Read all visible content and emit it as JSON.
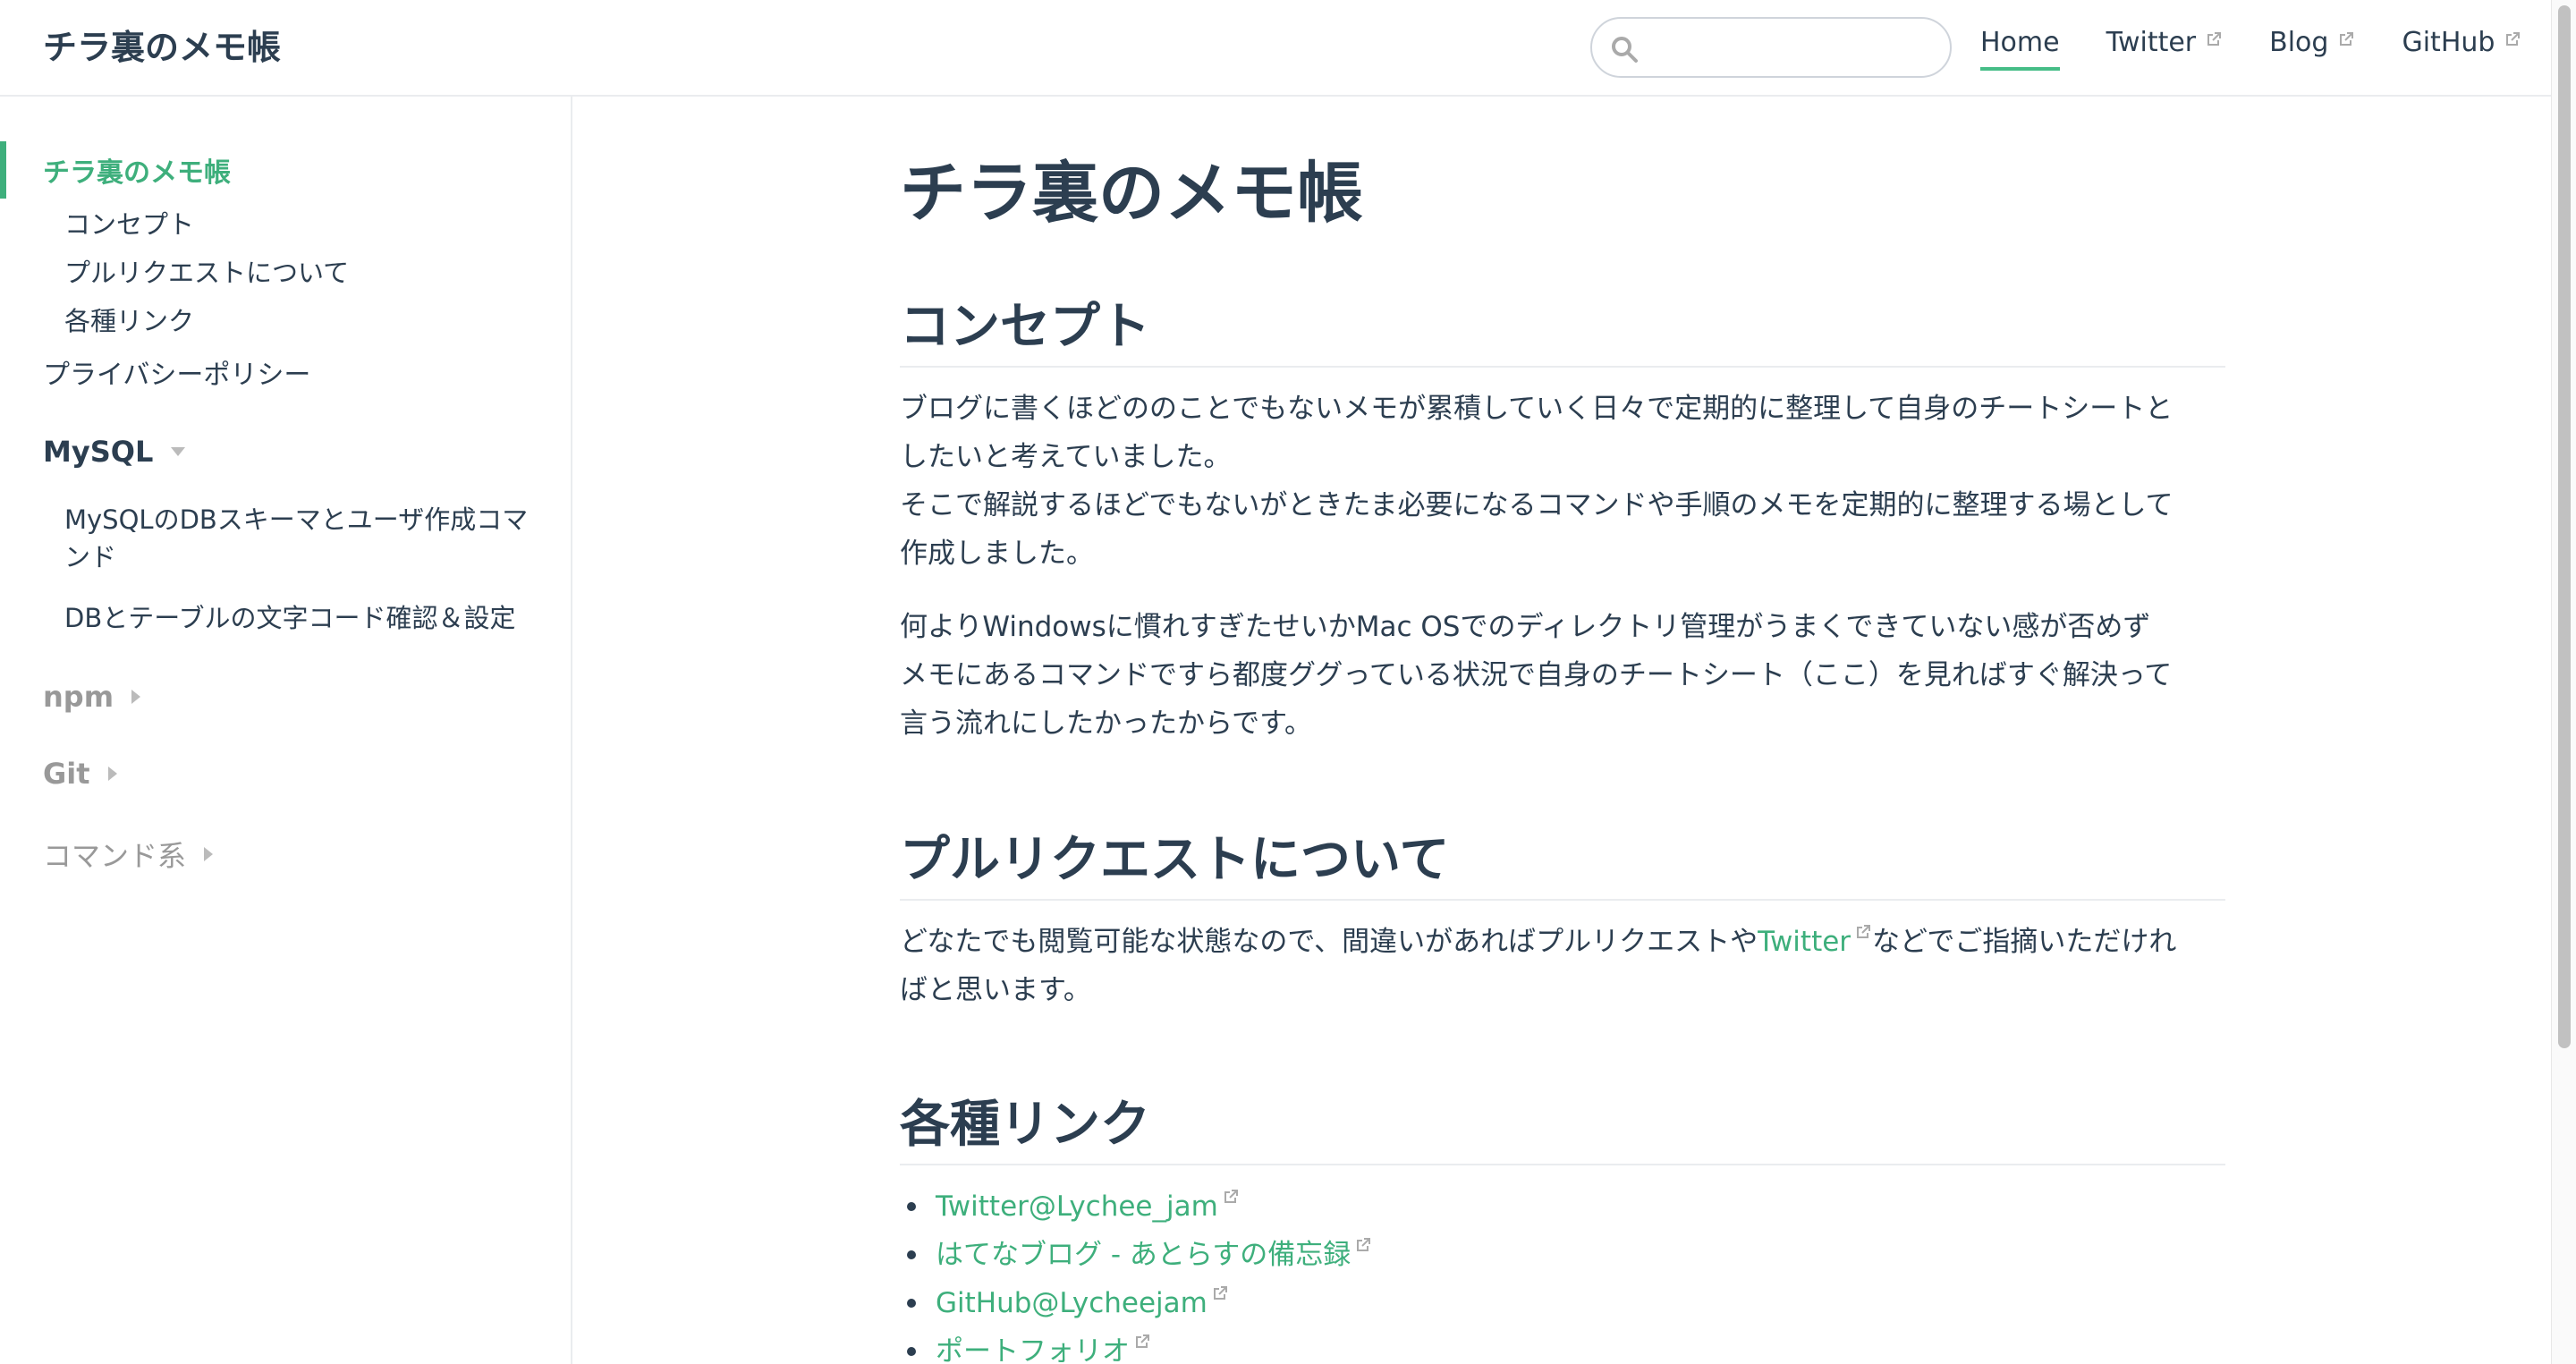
{
  "navbar": {
    "site_name": "チラ裏のメモ帳",
    "search": {
      "placeholder": "",
      "value": ""
    },
    "links": [
      {
        "label": "Home",
        "active": true,
        "external": false
      },
      {
        "label": "Twitter",
        "active": false,
        "external": true
      },
      {
        "label": "Blog",
        "active": false,
        "external": true
      },
      {
        "label": "GitHub",
        "active": false,
        "external": true
      }
    ]
  },
  "sidebar": {
    "top_item": "チラ裏のメモ帳",
    "sub_items": [
      "コンセプト",
      "プルリクエストについて",
      "各種リンク"
    ],
    "privacy": "プライバシーポリシー",
    "groups": [
      {
        "title": "MySQL",
        "expanded": true,
        "items": [
          "MySQLのDBスキーマとユーザ作成コマンド",
          "DBとテーブルの文字コード確認＆設定"
        ]
      },
      {
        "title": "npm",
        "expanded": false
      },
      {
        "title": "Git",
        "expanded": false
      },
      {
        "title": "コマンド系",
        "expanded": false
      }
    ],
    "mysql_item1_line1": "MySQLのDBスキーマとユーザ作成コマ",
    "mysql_item1_line2": "ンド"
  },
  "main": {
    "title": "チラ裏のメモ帳",
    "concept": {
      "heading": "コンセプト",
      "p1_lines": [
        "ブログに書くほどののことでもないメモが累積していく日々で定期的に整理して自身のチートシートと",
        "したいと考えていました。",
        "そこで解説するほどでもないがときたま必要になるコマンドや手順のメモを定期的に整理する場として",
        "作成しました。"
      ],
      "p2_lines": [
        "何よりWindowsに慣れすぎたせいかMac OSでのディレクトリ管理がうまくできていない感が否めず",
        "メモにあるコマンドですら都度ググっている状況で自身のチートシート（ここ）を見ればすぐ解決って",
        "言う流れにしたかったからです。"
      ]
    },
    "pr": {
      "heading": "プルリクエストについて",
      "text_before": "どなたでも閲覧可能な状態なので、間違いがあればプルリクエストや",
      "link": "Twitter",
      "text_after": "などでご指摘いただけれ",
      "line2": "ばと思います。"
    },
    "links": {
      "heading": "各種リンク",
      "items": [
        "Twitter@Lychee_jam",
        "はてなブログ - あとらすの備忘録",
        "GitHub@Lycheejam",
        "ポートフォリオ"
      ]
    }
  },
  "colors": {
    "accent": "#3eaf7c",
    "text": "#2c3e50",
    "border": "#eaecef"
  }
}
